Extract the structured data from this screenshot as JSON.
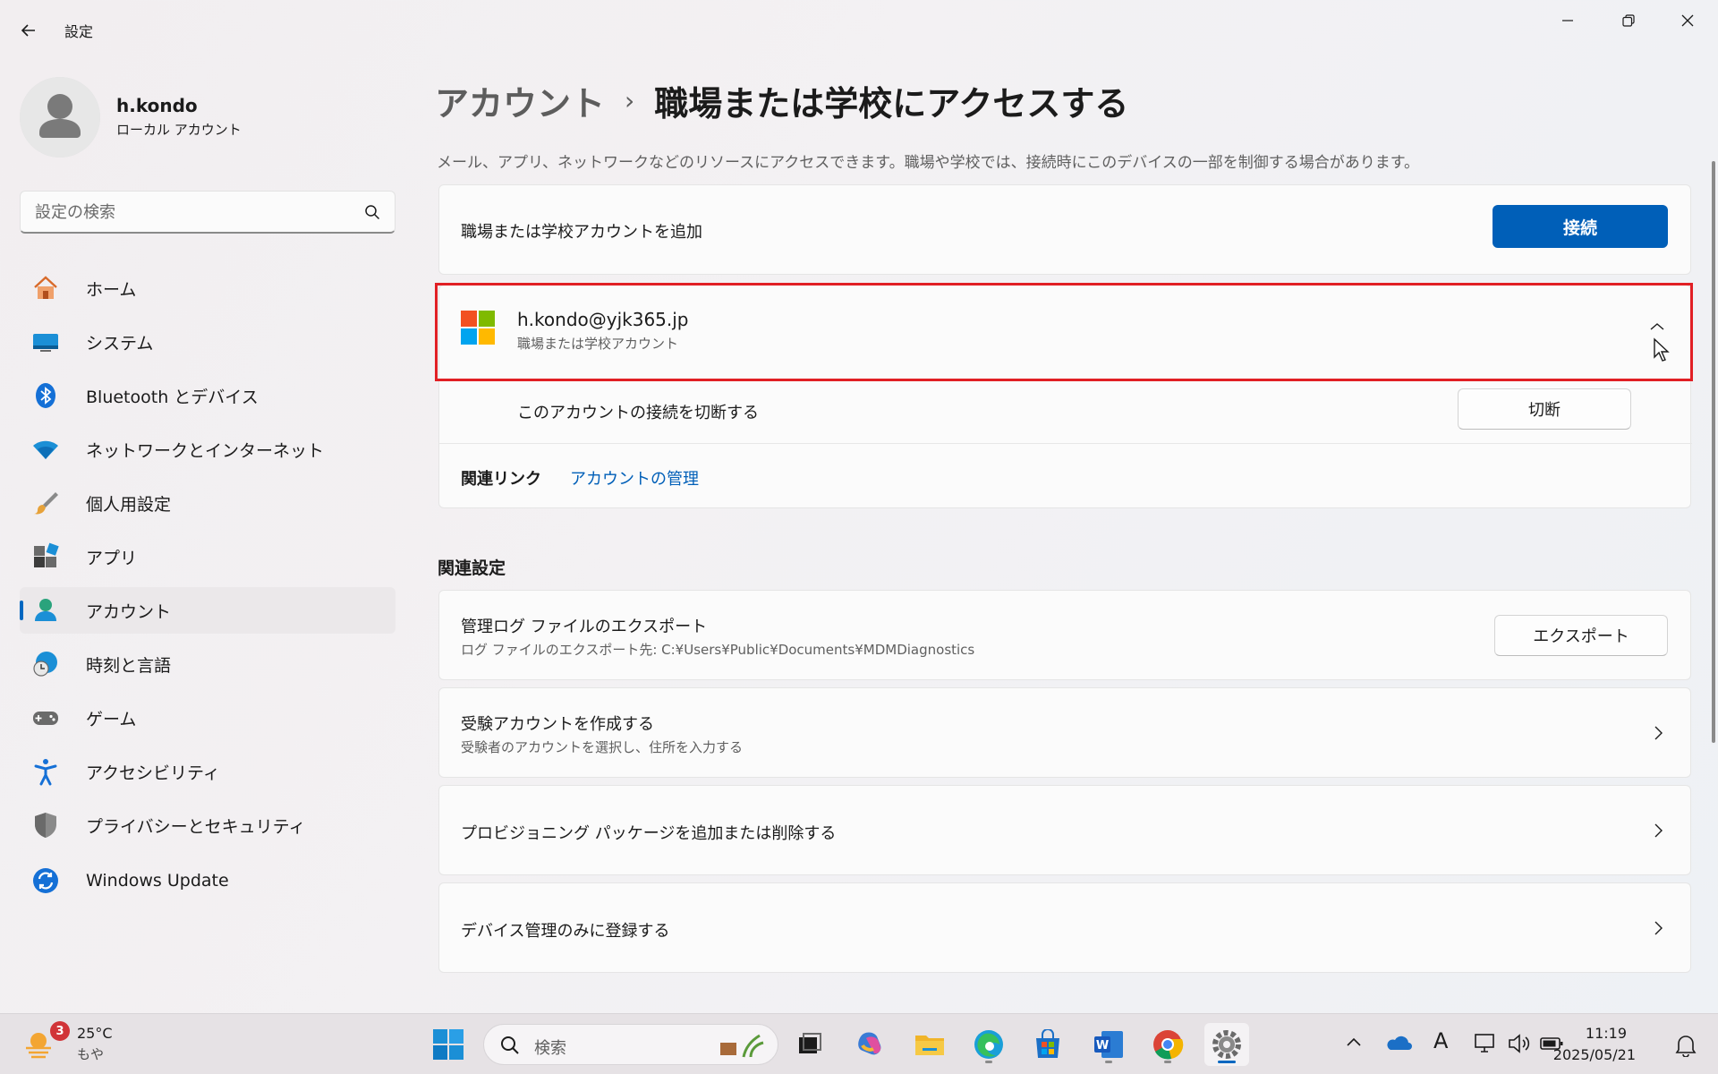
{
  "window": {
    "title": "設定"
  },
  "user": {
    "name": "h.kondo",
    "account_type": "ローカル アカウント"
  },
  "search": {
    "placeholder": "設定の検索"
  },
  "nav": {
    "items": [
      {
        "label": "ホーム",
        "icon": "home-icon"
      },
      {
        "label": "システム",
        "icon": "system-icon"
      },
      {
        "label": "Bluetooth とデバイス",
        "icon": "bluetooth-icon"
      },
      {
        "label": "ネットワークとインターネット",
        "icon": "wifi-icon"
      },
      {
        "label": "個人用設定",
        "icon": "brush-icon"
      },
      {
        "label": "アプリ",
        "icon": "apps-icon"
      },
      {
        "label": "アカウント",
        "icon": "account-icon",
        "active": true
      },
      {
        "label": "時刻と言語",
        "icon": "time-language-icon"
      },
      {
        "label": "ゲーム",
        "icon": "gamepad-icon"
      },
      {
        "label": "アクセシビリティ",
        "icon": "accessibility-icon"
      },
      {
        "label": "プライバシーとセキュリティ",
        "icon": "shield-icon"
      },
      {
        "label": "Windows Update",
        "icon": "update-icon"
      }
    ]
  },
  "breadcrumb": {
    "parent": "アカウント",
    "separator": "›",
    "current": "職場または学校にアクセスする"
  },
  "description": "メール、アプリ、ネットワークなどのリソースにアクセスできます。職場や学校では、接続時にこのデバイスの一部を制御する場合があります。",
  "add_account": {
    "label": "職場または学校アカウントを追加",
    "button": "接続"
  },
  "account": {
    "email": "h.kondo@yjk365.jp",
    "type": "職場または学校アカウント",
    "disconnect_label": "このアカウントの接続を切断する",
    "disconnect_button": "切断",
    "related_links_label": "関連リンク",
    "manage_link": "アカウントの管理"
  },
  "related_settings": {
    "heading": "関連設定",
    "export": {
      "title": "管理ログ ファイルのエクスポート",
      "subtitle": "ログ ファイルのエクスポート先: C:¥Users¥Public¥Documents¥MDMDiagnostics",
      "button": "エクスポート"
    },
    "exam": {
      "title": "受験アカウントを作成する",
      "subtitle": "受験者のアカウントを選択し、住所を入力する"
    },
    "provisioning": {
      "title": "プロビジョニング パッケージを追加または削除する"
    },
    "mdm_only": {
      "title": "デバイス管理のみに登録する"
    }
  },
  "taskbar": {
    "weather": {
      "badge": "3",
      "temp": "25°C",
      "desc": "もや"
    },
    "search_label": "検索",
    "clock": {
      "time": "11:19",
      "date": "2025/05/21"
    },
    "ime": "A"
  },
  "colors": {
    "accent": "#005fb8",
    "highlight": "#e11f24"
  }
}
